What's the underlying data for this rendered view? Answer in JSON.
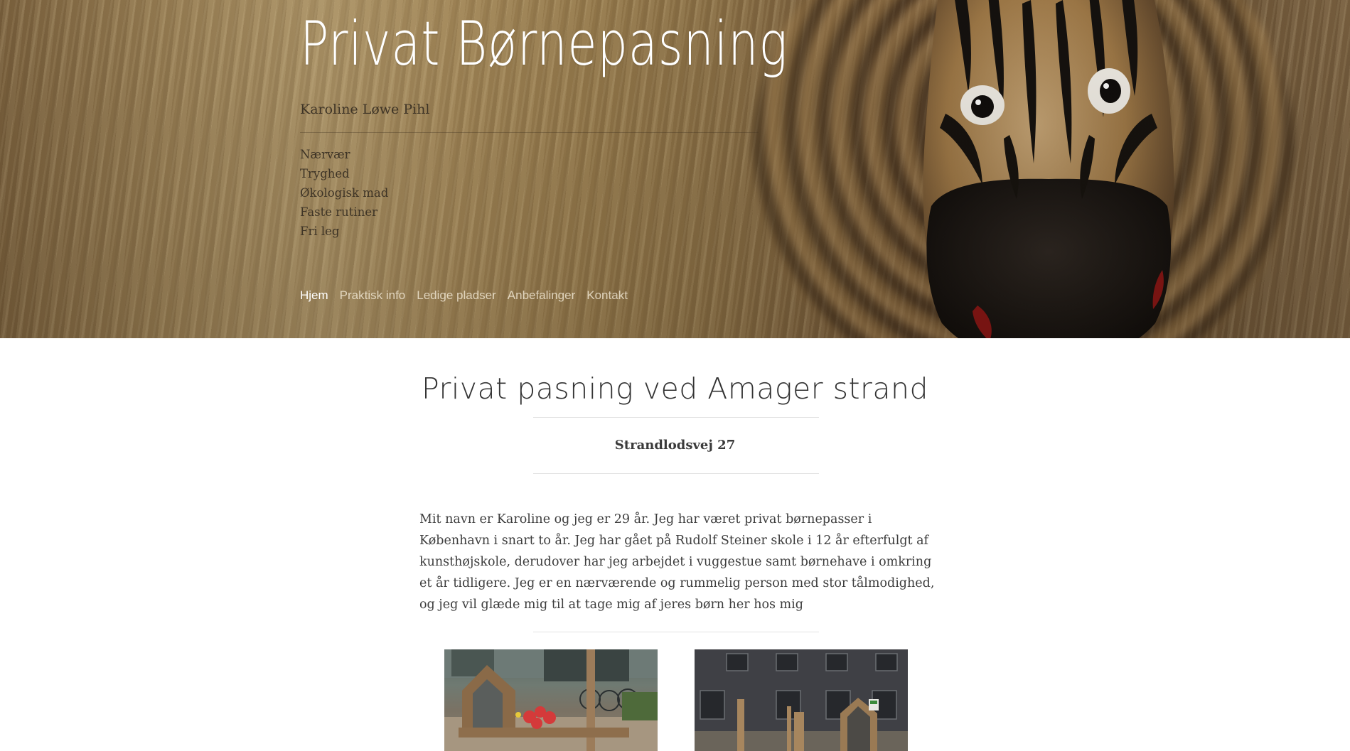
{
  "header": {
    "site_title": "Privat Børnepasning",
    "subtitle": "Karoline Løwe Pihl",
    "values": [
      "Nærvær",
      "Tryghed",
      "Økologisk mad",
      "Faste rutiner",
      "Fri leg"
    ]
  },
  "nav": {
    "items": [
      {
        "label": "Hjem",
        "active": true
      },
      {
        "label": "Praktisk info",
        "active": false
      },
      {
        "label": "Ledige pladser",
        "active": false
      },
      {
        "label": "Anbefalinger",
        "active": false
      },
      {
        "label": "Kontakt",
        "active": false
      }
    ]
  },
  "main": {
    "title": "Privat pasning ved Amager strand",
    "address": "Strandlodsvej 27",
    "intro": "Mit navn er Karoline og jeg er 29 år. Jeg har været privat børnepasser i København i snart to år. Jeg har gået på Rudolf Steiner skole i 12 år efterfulgt af kunsthøjskole, derudover har jeg arbejdet i vuggestue samt børnehave i omkring et år tidligere. Jeg er en nærværende og rummelig person med stor tålmodighed, og jeg vil glæde mig til at tage mig af jeres børn her hos mig"
  },
  "colors": {
    "nav_active": "#ffffff",
    "heading": "#333333",
    "body_text": "#3d3d3d"
  }
}
